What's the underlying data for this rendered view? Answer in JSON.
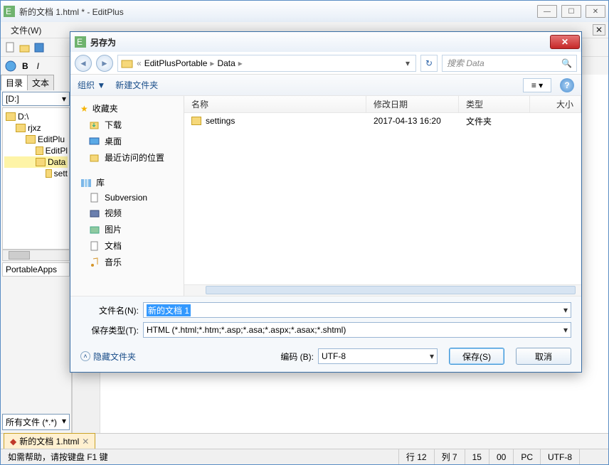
{
  "main": {
    "title": "新的文档 1.html * - EditPlus",
    "menu": {
      "file": "文件(W)"
    },
    "left": {
      "tab_dir": "目录",
      "tab_text": "文本",
      "drive": "[D:]",
      "tree": [
        "D:\\",
        "rjxz",
        "EditPlu",
        "EditPl",
        "Data",
        "sett"
      ],
      "portable": "PortableApps",
      "filter": "所有文件 (*.*)"
    },
    "doc_tab": "新的文档 1.html",
    "status": {
      "help": "如需帮助，请按键盘 F1 键",
      "line": "行 12",
      "col": "列 7",
      "n1": "15",
      "n2": "00",
      "mode": "PC",
      "enc": "UTF-8"
    }
  },
  "dialog": {
    "title": "另存为",
    "breadcrumb": {
      "seg1": "EditPlusPortable",
      "seg2": "Data"
    },
    "search_placeholder": "搜索 Data",
    "toolbar": {
      "organize": "组织",
      "newfolder": "新建文件夹"
    },
    "sidebar": {
      "favorites": "收藏夹",
      "downloads": "下载",
      "desktop": "桌面",
      "recent": "最近访问的位置",
      "libraries": "库",
      "subversion": "Subversion",
      "videos": "视频",
      "pictures": "图片",
      "documents": "文档",
      "music": "音乐"
    },
    "columns": {
      "name": "名称",
      "date": "修改日期",
      "type": "类型",
      "size": "大小"
    },
    "files": [
      {
        "name": "settings",
        "date": "2017-04-13 16:20",
        "type": "文件夹"
      }
    ],
    "labels": {
      "filename": "文件名(N):",
      "filetype": "保存类型(T):",
      "encoding": "编码 (B):",
      "hide": "隐藏文件夹",
      "save": "保存(S)",
      "cancel": "取消"
    },
    "values": {
      "filename": "新的文档 1",
      "filetype": "HTML (*.html;*.htm;*.asp;*.asa;*.aspx;*.asax;*.shtml)",
      "encoding": "UTF-8"
    }
  }
}
